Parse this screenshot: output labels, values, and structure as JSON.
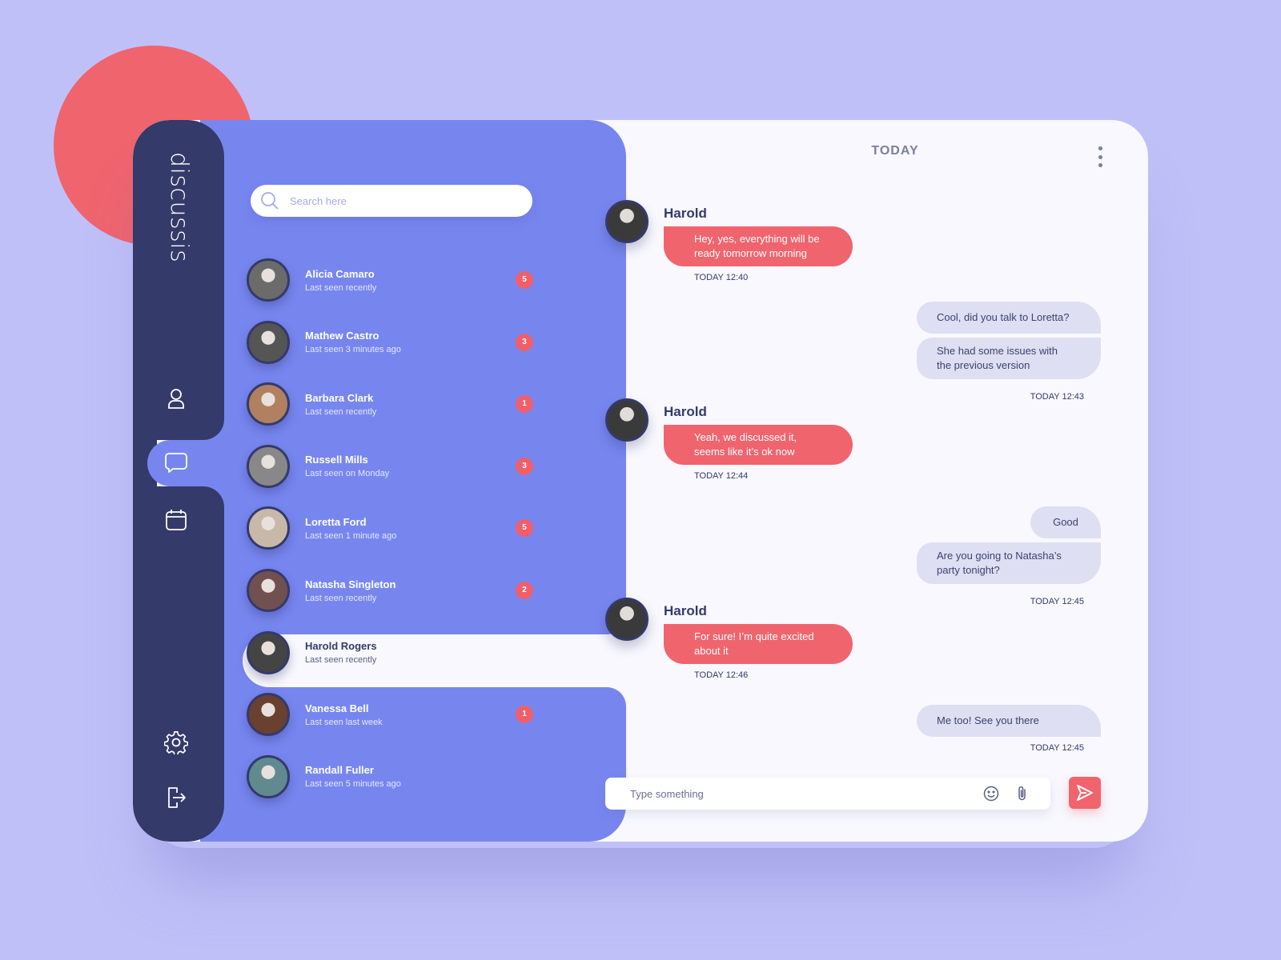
{
  "app": {
    "brand": "discussis"
  },
  "colors": {
    "accent": "#f0646e",
    "rail": "#343a69",
    "list": "#7786ef",
    "chat_bg": "#f8f8fe",
    "bubble_out": "#dedff2"
  },
  "rail": {
    "items": [
      {
        "name": "profile",
        "icon": "user-icon"
      },
      {
        "name": "chats",
        "icon": "chat-bubble-icon",
        "active": true
      },
      {
        "name": "calendar",
        "icon": "calendar-icon"
      },
      {
        "name": "settings",
        "icon": "gear-icon"
      },
      {
        "name": "logout",
        "icon": "logout-icon"
      }
    ]
  },
  "search": {
    "placeholder": "Search here",
    "value": ""
  },
  "contacts": [
    {
      "name": "Alicia Camaro",
      "seen": "Last seen recently",
      "unread": "5"
    },
    {
      "name": "Mathew Castro",
      "seen": "Last seen 3 minutes ago",
      "unread": "3"
    },
    {
      "name": "Barbara Clark",
      "seen": "Last seen recently",
      "unread": "1"
    },
    {
      "name": "Russell Mills",
      "seen": "Last seen on Monday",
      "unread": "3"
    },
    {
      "name": "Loretta Ford",
      "seen": "Last seen 1 minute ago",
      "unread": "5"
    },
    {
      "name": "Natasha Singleton",
      "seen": "Last seen recently",
      "unread": "2"
    },
    {
      "name": "Harold Rogers",
      "seen": "Last seen recently",
      "unread": null,
      "active": true
    },
    {
      "name": "Vanessa Bell",
      "seen": "Last seen last week",
      "unread": "1"
    },
    {
      "name": "Randall Fuller",
      "seen": "Last seen 5 minutes ago",
      "unread": null
    }
  ],
  "chat": {
    "header": "TODAY",
    "messages": [
      {
        "direction": "in",
        "sender": "Harold",
        "lines": [
          "Hey, yes, everything will be",
          "ready tomorrow morning"
        ],
        "time": "TODAY 12:40"
      },
      {
        "direction": "out",
        "bubbles": [
          [
            "Cool, did you talk to Loretta?"
          ],
          [
            "She had some issues with",
            "the previous version"
          ]
        ],
        "time": "TODAY 12:43"
      },
      {
        "direction": "in",
        "sender": "Harold",
        "lines": [
          "Yeah, we discussed it,",
          "seems like it’s ok now"
        ],
        "time": "TODAY 12:44"
      },
      {
        "direction": "out",
        "bubbles": [
          [
            "Good"
          ],
          [
            "Are you going to Natasha’s",
            "party tonight?"
          ]
        ],
        "time": "TODAY 12:45"
      },
      {
        "direction": "in",
        "sender": "Harold",
        "lines": [
          "For sure! I’m quite excited",
          "about it"
        ],
        "time": "TODAY 12:46"
      },
      {
        "direction": "out",
        "bubbles": [
          [
            "Me too! See you there"
          ]
        ],
        "time": "TODAY 12:45"
      }
    ],
    "composer": {
      "placeholder": "Type something",
      "value": ""
    }
  }
}
